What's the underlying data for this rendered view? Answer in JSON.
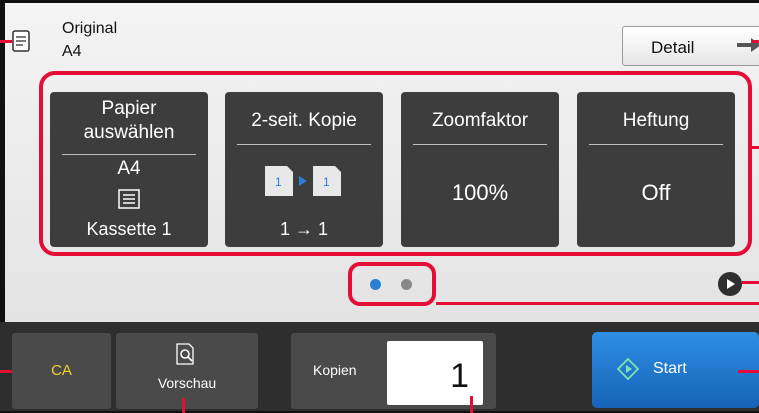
{
  "header": {
    "original_label": "Original",
    "original_size": "A4",
    "detail_button": "Detail"
  },
  "tiles": [
    {
      "title_line1": "Papier",
      "title_line2": "auswählen",
      "size": "A4",
      "tray": "Kassette 1"
    },
    {
      "title": "2-seit. Kopie",
      "mode": "1 → 1"
    },
    {
      "title": "Zoomfaktor",
      "value": "100%"
    },
    {
      "title": "Heftung",
      "value": "Off"
    }
  ],
  "pager": {
    "page_count": 2,
    "active_page": 1,
    "active_color": "#2a7fd4",
    "inactive_color": "#888888"
  },
  "bottom": {
    "ca_label": "CA",
    "preview_label": "Vorschau",
    "copies_label": "Kopien",
    "copies_value": "1",
    "start_label": "Start"
  },
  "colors": {
    "callout": "#e50c36",
    "tile_bg": "#3d3d3d",
    "bottom_bar": "#2e2e2e",
    "start_button": "#2077cc",
    "ca_text": "#f0d22a"
  },
  "icons": [
    "original-doc-icon",
    "arrow-right-icon",
    "paper-tray-icon",
    "duplex-copy-icon",
    "next-page-icon",
    "preview-magnifier-icon",
    "start-icon"
  ]
}
